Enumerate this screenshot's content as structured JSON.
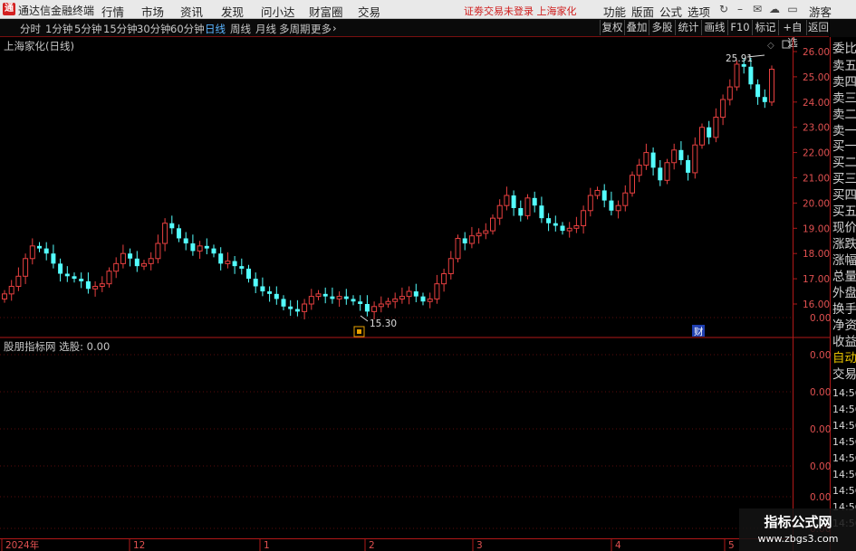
{
  "app": {
    "title": "通达信金融终端",
    "logo_text": "通",
    "menus": [
      "行情",
      "市场",
      "资讯",
      "发现",
      "问小达",
      "财富圈",
      "交易"
    ],
    "notice": "证劵交易未登录  上海家化",
    "right_menus": [
      "功能",
      "版面",
      "公式",
      "选项"
    ],
    "guest": "游客",
    "icons": [
      "refresh-icon",
      "minimize-icon",
      "mail-icon",
      "cloud-icon",
      "window-icon"
    ]
  },
  "toolbar": {
    "periods": [
      "分时",
      "1分钟",
      "5分钟",
      "15分钟",
      "30分钟",
      "60分钟",
      "日线",
      "周线",
      "月线",
      "多周期",
      "更多"
    ],
    "active": "日线",
    "right_buttons": [
      "复权",
      "叠加",
      "多股",
      "统计",
      "画线",
      "F10",
      "标记",
      "+自选",
      "返回"
    ]
  },
  "chart": {
    "stock_title": "上海家化(日线)",
    "high_label": "25.91",
    "low_label": "15.30",
    "cai_badge": "财",
    "price_ticks": [
      "26.00",
      "25.00",
      "24.00",
      "23.00",
      "22.00",
      "21.00",
      "20.00",
      "19.00",
      "18.00",
      "17.00",
      "16.00"
    ],
    "indicator_title": "股朋指标网  选股: 0.00",
    "indicator_ticks": [
      "0.00",
      "0.00",
      "0.00",
      "0.00",
      "0.00",
      "0.00",
      "0.00"
    ],
    "time_labels": [
      "2024年",
      "12",
      "1",
      "2",
      "3",
      "4",
      "5"
    ],
    "up_color": "#e84040",
    "down_color": "#54ffff"
  },
  "chart_data": {
    "type": "candlestick",
    "title": "上海家化(日线)",
    "ylim": [
      15.3,
      26.2
    ],
    "high": 25.91,
    "low": 15.3,
    "x_labels": [
      "2024年",
      "12",
      "1",
      "2",
      "3",
      "4",
      "5"
    ],
    "closes": [
      16.4,
      16.7,
      17.1,
      17.8,
      18.3,
      18.2,
      18.0,
      17.6,
      17.2,
      17.1,
      17.0,
      16.9,
      16.6,
      16.7,
      16.8,
      17.3,
      17.6,
      18.0,
      17.8,
      17.5,
      17.6,
      17.8,
      18.4,
      19.2,
      19.0,
      18.6,
      18.4,
      18.1,
      18.3,
      18.2,
      18.0,
      17.6,
      17.7,
      17.5,
      17.4,
      17.0,
      16.7,
      16.5,
      16.4,
      16.2,
      15.9,
      15.8,
      15.7,
      16.0,
      16.3,
      16.4,
      16.3,
      16.2,
      16.3,
      16.2,
      16.1,
      16.0,
      15.7,
      15.9,
      16.0,
      16.1,
      16.2,
      16.3,
      16.5,
      16.3,
      16.1,
      16.2,
      16.8,
      17.2,
      17.8,
      18.6,
      18.4,
      18.7,
      18.8,
      18.9,
      19.4,
      19.9,
      20.3,
      19.8,
      19.5,
      20.2,
      19.9,
      19.4,
      19.2,
      19.1,
      18.9,
      19.0,
      19.1,
      19.7,
      20.3,
      20.5,
      20.1,
      19.7,
      19.9,
      20.4,
      21.1,
      21.5,
      22.0,
      21.4,
      20.9,
      21.6,
      22.1,
      21.7,
      21.2,
      22.3,
      23.0,
      22.6,
      23.4,
      24.1,
      24.6,
      25.5,
      25.4,
      24.7,
      24.2,
      24.0,
      25.3
    ]
  }
}
